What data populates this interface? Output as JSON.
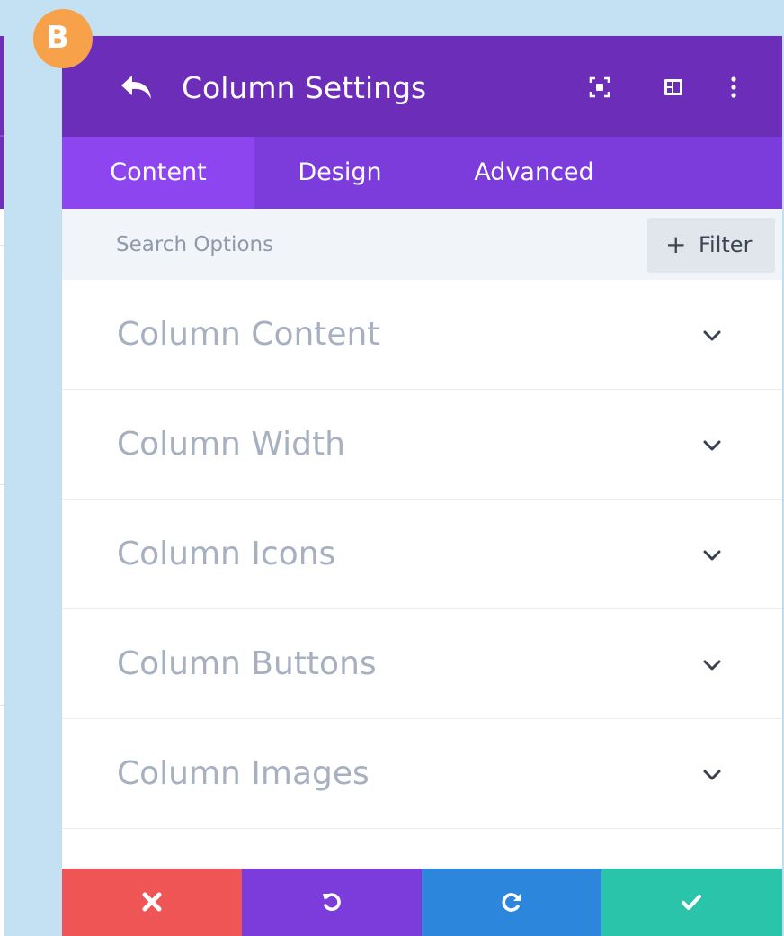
{
  "badge": {
    "letter": "B",
    "color": "#f7a24a"
  },
  "header": {
    "title": "Column Settings",
    "background": "#6c2eb9",
    "icons": [
      "back-icon",
      "expand-icon",
      "split-view-icon",
      "more-options-icon"
    ]
  },
  "tabs": [
    {
      "label": "Content",
      "active": true
    },
    {
      "label": "Design",
      "active": false
    },
    {
      "label": "Advanced",
      "active": false
    }
  ],
  "search": {
    "placeholder": "Search Options",
    "value": ""
  },
  "filter": {
    "label": "Filter",
    "icon": "plus-icon"
  },
  "sections": [
    {
      "label": "Column Content"
    },
    {
      "label": "Column Width"
    },
    {
      "label": "Column Icons"
    },
    {
      "label": "Column Buttons"
    },
    {
      "label": "Column Images"
    }
  ],
  "footer": {
    "buttons": [
      {
        "name": "discard",
        "icon": "close-icon",
        "color": "#ef5555"
      },
      {
        "name": "undo",
        "icon": "undo-icon",
        "color": "#7c3cdb"
      },
      {
        "name": "redo",
        "icon": "redo-icon",
        "color": "#2b86dc"
      },
      {
        "name": "save",
        "icon": "check-icon",
        "color": "#29c4a9"
      }
    ]
  },
  "colors": {
    "page_background": "#c4e1f3",
    "tab_bar": "#7c3cdb",
    "active_tab": "#8d46ef",
    "section_text": "#a7b0c0"
  }
}
